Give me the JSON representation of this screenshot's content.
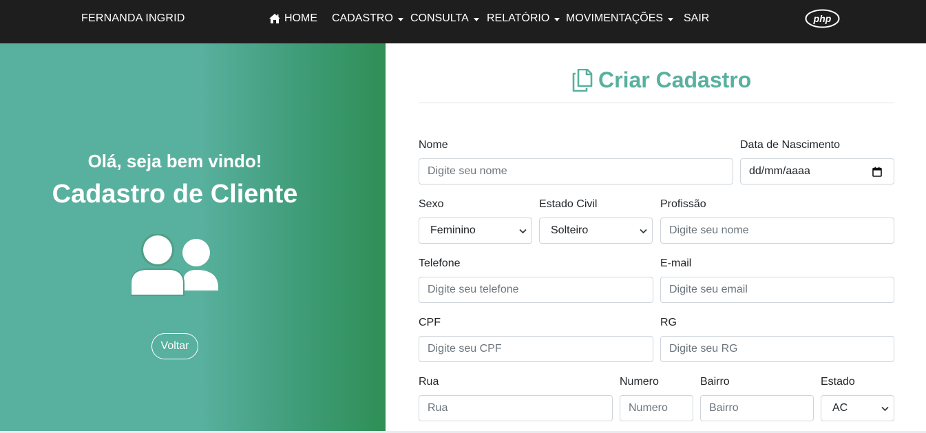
{
  "navbar": {
    "brand": "FERNANDA INGRID",
    "items": [
      {
        "label": "HOME",
        "icon": "home-icon",
        "dropdown": false
      },
      {
        "label": "CADASTRO",
        "dropdown": true
      },
      {
        "label": "CONSULTA",
        "dropdown": true
      },
      {
        "label": "RELATÓRIO",
        "dropdown": true
      },
      {
        "label": "MOVIMENTAÇÕES",
        "dropdown": true
      },
      {
        "label": "SAIR",
        "dropdown": false
      }
    ],
    "logo": "php"
  },
  "left_panel": {
    "welcome": "Olá, seja bem vindo!",
    "title": "Cadastro de Cliente",
    "icon": "users-icon",
    "back_button": "Voltar",
    "colors": {
      "from": "#58b09e",
      "to": "#2f8f55"
    }
  },
  "form": {
    "title": "Criar Cadastro",
    "title_icon": "copy-icon",
    "accent": "#58b09e",
    "nome": {
      "label": "Nome",
      "placeholder": "Digite seu nome"
    },
    "nascimento": {
      "label": "Data de Nascimento",
      "value": "dd/mm/aaaa"
    },
    "sexo": {
      "label": "Sexo",
      "value": "Feminino"
    },
    "estado_civil": {
      "label": "Estado Civil",
      "value": "Solteiro"
    },
    "profissao": {
      "label": "Profissão",
      "placeholder": "Digite seu nome"
    },
    "telefone": {
      "label": "Telefone",
      "placeholder": "Digite seu telefone"
    },
    "email": {
      "label": "E-mail",
      "placeholder": "Digite seu email"
    },
    "cpf": {
      "label": "CPF",
      "placeholder": "Digite seu CPF"
    },
    "rg": {
      "label": "RG",
      "placeholder": "Digite seu RG"
    },
    "rua": {
      "label": "Rua",
      "placeholder": "Rua"
    },
    "numero": {
      "label": "Numero",
      "placeholder": "Numero"
    },
    "bairro": {
      "label": "Bairro",
      "placeholder": "Bairro"
    },
    "estado": {
      "label": "Estado",
      "value": "AC"
    }
  }
}
